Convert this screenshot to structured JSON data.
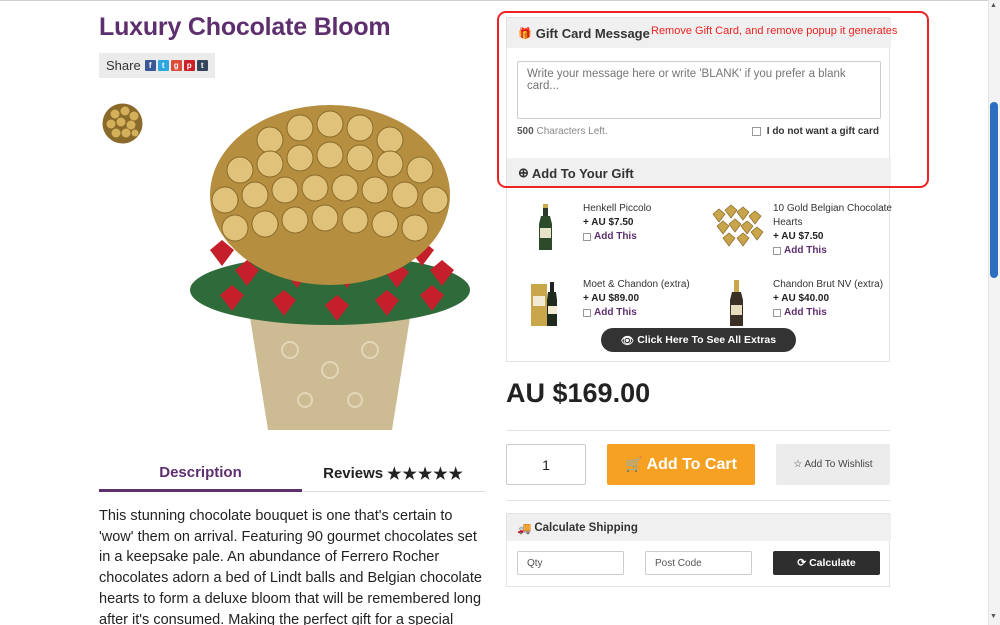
{
  "product": {
    "title": "Luxury Chocolate Bloom",
    "share_label": "Share",
    "share_icons": [
      "facebook-icon",
      "twitter-icon",
      "google-plus-icon",
      "pinterest-icon",
      "tumblr-icon"
    ],
    "price": "AU $169.00"
  },
  "tabs": {
    "description": "Description",
    "reviews": "Reviews",
    "reviews_stars": "★★★★★"
  },
  "description_text": "This stunning chocolate bouquet is one that's certain to 'wow' them on arrival.  Featuring 90 gourmet chocolates set in a keepsake pale.  An abundance of Ferrero Rocher chocolates adorn a bed of Lindt balls and Belgian chocolate hearts to form a deluxe bloom that will be remembered long after it's consumed.  Making the perfect gift for a special",
  "gift_card": {
    "heading": "Gift Card Message",
    "placeholder": "Write your message here or write 'BLANK' if you prefer a blank card...",
    "chars_count": "500",
    "chars_label": "Characters Left.",
    "no_card_label": "I do not want a gift card"
  },
  "annotation": "Remove Gift Card, and remove popup  it generates",
  "extras": {
    "heading": "Add To Your Gift",
    "items": [
      {
        "name": "Henkell Piccolo",
        "price": "+ AU $7.50",
        "action": "Add This"
      },
      {
        "name": "10 Gold Belgian Chocolate Hearts",
        "price": "+ AU $7.50",
        "action": "Add This"
      },
      {
        "name": "Moet & Chandon (extra)",
        "price": "+ AU $89.00",
        "action": "Add This"
      },
      {
        "name": "Chandon Brut NV (extra)",
        "price": "+ AU $40.00",
        "action": "Add This"
      }
    ],
    "see_all": "Click Here To See All Extras"
  },
  "cart": {
    "quantity": "1",
    "add_to_cart": "Add To Cart",
    "add_to_wishlist": "Add To Wishlist"
  },
  "shipping": {
    "heading": "Calculate Shipping",
    "qty_placeholder": "Qty",
    "postcode_placeholder": "Post Code",
    "calculate": "Calculate"
  },
  "colors": {
    "brand_purple": "#5d2f6e",
    "cart_orange": "#f7a123",
    "annotation_red": "#ee2222",
    "scroll_blue": "#2c6fc0"
  }
}
